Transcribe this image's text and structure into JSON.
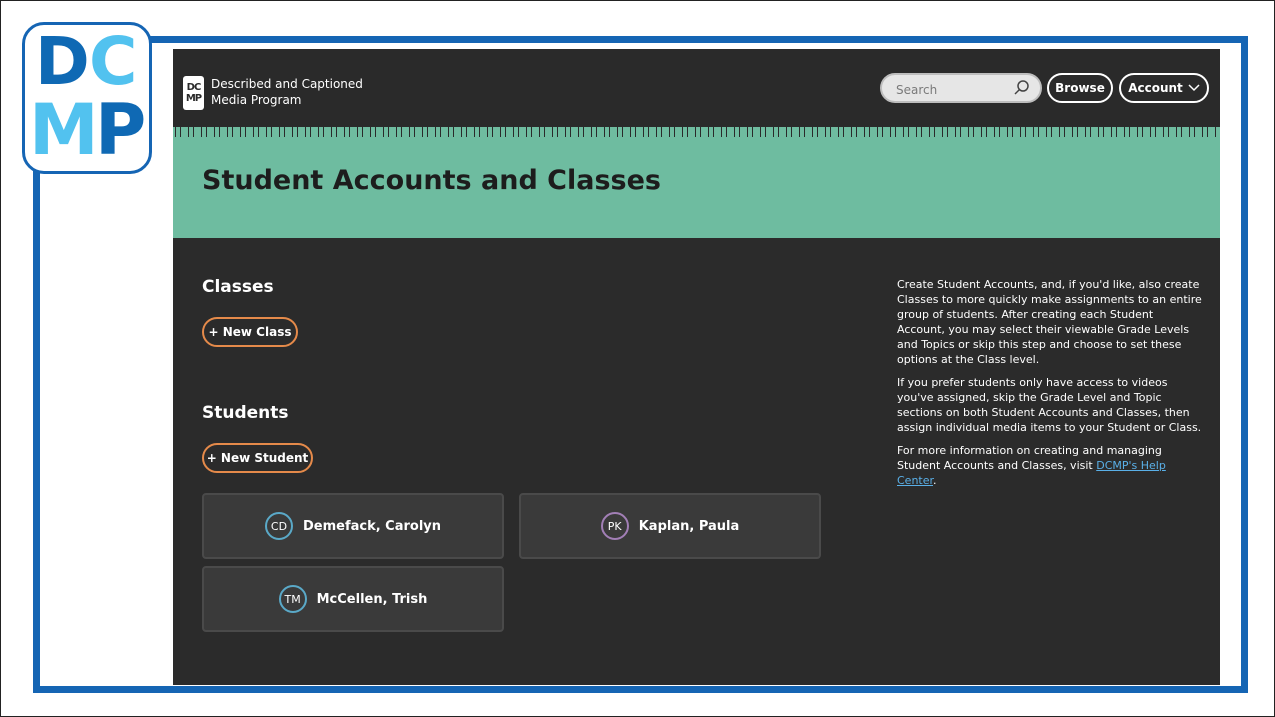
{
  "logo": {
    "letters": [
      "D",
      "C",
      "M",
      "P"
    ]
  },
  "site": {
    "mark_top": "DC",
    "mark_bottom": "MP",
    "name_line1": "Described and Captioned",
    "name_line2": "Media Program"
  },
  "header": {
    "search_placeholder": "Search",
    "browse_label": "Browse",
    "account_label": "Account"
  },
  "page": {
    "title": "Student Accounts and Classes"
  },
  "classes": {
    "heading": "Classes",
    "new_label": "+ New Class"
  },
  "students": {
    "heading": "Students",
    "new_label": "+ New Student",
    "items": [
      {
        "initials": "CD",
        "name": "Demefack, Carolyn",
        "color": "#5aa9c8"
      },
      {
        "initials": "PK",
        "name": "Kaplan, Paula",
        "color": "#a27fb6"
      },
      {
        "initials": "TM",
        "name": "McCellen, Trish",
        "color": "#5aa9c8"
      }
    ]
  },
  "info": {
    "p1": "Create Student Accounts, and, if you'd like, also create Classes to more quickly make assignments to an entire group of students. After creating each Student Account, you may select their viewable Grade Levels and Topics or skip this step and choose to set these options at the Class level.",
    "p2": "If you prefer students only have access to videos you've assigned, skip the Grade Level and Topic sections on both Student Accounts and Classes, then assign individual media items to your Student or Class.",
    "p3_prefix": "For more information on creating and managing Student Accounts and Classes, visit ",
    "p3_link": "DCMP's Help Center",
    "p3_suffix": "."
  },
  "colors": {
    "frame_blue": "#1565b4",
    "logo_blue": "#0f69b4",
    "logo_cyan": "#52c2ef",
    "hero_green": "#6ebca0",
    "button_orange": "#e58a4a",
    "link_blue": "#5ab0e8"
  }
}
